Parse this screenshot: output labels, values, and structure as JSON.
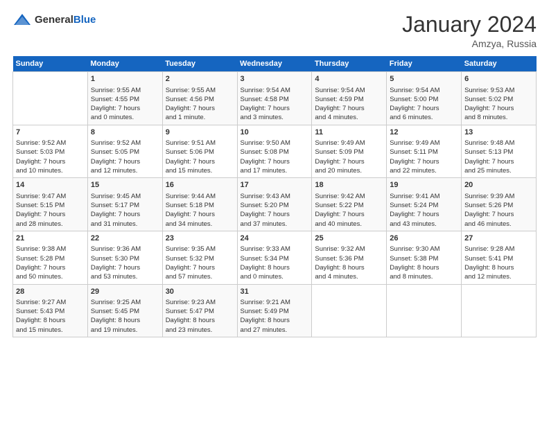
{
  "header": {
    "logo_general": "General",
    "logo_blue": "Blue",
    "main_title": "January 2024",
    "subtitle": "Amzya, Russia"
  },
  "calendar": {
    "days_of_week": [
      "Sunday",
      "Monday",
      "Tuesday",
      "Wednesday",
      "Thursday",
      "Friday",
      "Saturday"
    ],
    "weeks": [
      [
        {
          "day": "",
          "content": ""
        },
        {
          "day": "1",
          "content": "Sunrise: 9:55 AM\nSunset: 4:55 PM\nDaylight: 7 hours\nand 0 minutes."
        },
        {
          "day": "2",
          "content": "Sunrise: 9:55 AM\nSunset: 4:56 PM\nDaylight: 7 hours\nand 1 minute."
        },
        {
          "day": "3",
          "content": "Sunrise: 9:54 AM\nSunset: 4:58 PM\nDaylight: 7 hours\nand 3 minutes."
        },
        {
          "day": "4",
          "content": "Sunrise: 9:54 AM\nSunset: 4:59 PM\nDaylight: 7 hours\nand 4 minutes."
        },
        {
          "day": "5",
          "content": "Sunrise: 9:54 AM\nSunset: 5:00 PM\nDaylight: 7 hours\nand 6 minutes."
        },
        {
          "day": "6",
          "content": "Sunrise: 9:53 AM\nSunset: 5:02 PM\nDaylight: 7 hours\nand 8 minutes."
        }
      ],
      [
        {
          "day": "7",
          "content": "Sunrise: 9:52 AM\nSunset: 5:03 PM\nDaylight: 7 hours\nand 10 minutes."
        },
        {
          "day": "8",
          "content": "Sunrise: 9:52 AM\nSunset: 5:05 PM\nDaylight: 7 hours\nand 12 minutes."
        },
        {
          "day": "9",
          "content": "Sunrise: 9:51 AM\nSunset: 5:06 PM\nDaylight: 7 hours\nand 15 minutes."
        },
        {
          "day": "10",
          "content": "Sunrise: 9:50 AM\nSunset: 5:08 PM\nDaylight: 7 hours\nand 17 minutes."
        },
        {
          "day": "11",
          "content": "Sunrise: 9:49 AM\nSunset: 5:09 PM\nDaylight: 7 hours\nand 20 minutes."
        },
        {
          "day": "12",
          "content": "Sunrise: 9:49 AM\nSunset: 5:11 PM\nDaylight: 7 hours\nand 22 minutes."
        },
        {
          "day": "13",
          "content": "Sunrise: 9:48 AM\nSunset: 5:13 PM\nDaylight: 7 hours\nand 25 minutes."
        }
      ],
      [
        {
          "day": "14",
          "content": "Sunrise: 9:47 AM\nSunset: 5:15 PM\nDaylight: 7 hours\nand 28 minutes."
        },
        {
          "day": "15",
          "content": "Sunrise: 9:45 AM\nSunset: 5:17 PM\nDaylight: 7 hours\nand 31 minutes."
        },
        {
          "day": "16",
          "content": "Sunrise: 9:44 AM\nSunset: 5:18 PM\nDaylight: 7 hours\nand 34 minutes."
        },
        {
          "day": "17",
          "content": "Sunrise: 9:43 AM\nSunset: 5:20 PM\nDaylight: 7 hours\nand 37 minutes."
        },
        {
          "day": "18",
          "content": "Sunrise: 9:42 AM\nSunset: 5:22 PM\nDaylight: 7 hours\nand 40 minutes."
        },
        {
          "day": "19",
          "content": "Sunrise: 9:41 AM\nSunset: 5:24 PM\nDaylight: 7 hours\nand 43 minutes."
        },
        {
          "day": "20",
          "content": "Sunrise: 9:39 AM\nSunset: 5:26 PM\nDaylight: 7 hours\nand 46 minutes."
        }
      ],
      [
        {
          "day": "21",
          "content": "Sunrise: 9:38 AM\nSunset: 5:28 PM\nDaylight: 7 hours\nand 50 minutes."
        },
        {
          "day": "22",
          "content": "Sunrise: 9:36 AM\nSunset: 5:30 PM\nDaylight: 7 hours\nand 53 minutes."
        },
        {
          "day": "23",
          "content": "Sunrise: 9:35 AM\nSunset: 5:32 PM\nDaylight: 7 hours\nand 57 minutes."
        },
        {
          "day": "24",
          "content": "Sunrise: 9:33 AM\nSunset: 5:34 PM\nDaylight: 8 hours\nand 0 minutes."
        },
        {
          "day": "25",
          "content": "Sunrise: 9:32 AM\nSunset: 5:36 PM\nDaylight: 8 hours\nand 4 minutes."
        },
        {
          "day": "26",
          "content": "Sunrise: 9:30 AM\nSunset: 5:38 PM\nDaylight: 8 hours\nand 8 minutes."
        },
        {
          "day": "27",
          "content": "Sunrise: 9:28 AM\nSunset: 5:41 PM\nDaylight: 8 hours\nand 12 minutes."
        }
      ],
      [
        {
          "day": "28",
          "content": "Sunrise: 9:27 AM\nSunset: 5:43 PM\nDaylight: 8 hours\nand 15 minutes."
        },
        {
          "day": "29",
          "content": "Sunrise: 9:25 AM\nSunset: 5:45 PM\nDaylight: 8 hours\nand 19 minutes."
        },
        {
          "day": "30",
          "content": "Sunrise: 9:23 AM\nSunset: 5:47 PM\nDaylight: 8 hours\nand 23 minutes."
        },
        {
          "day": "31",
          "content": "Sunrise: 9:21 AM\nSunset: 5:49 PM\nDaylight: 8 hours\nand 27 minutes."
        },
        {
          "day": "",
          "content": ""
        },
        {
          "day": "",
          "content": ""
        },
        {
          "day": "",
          "content": ""
        }
      ]
    ]
  }
}
